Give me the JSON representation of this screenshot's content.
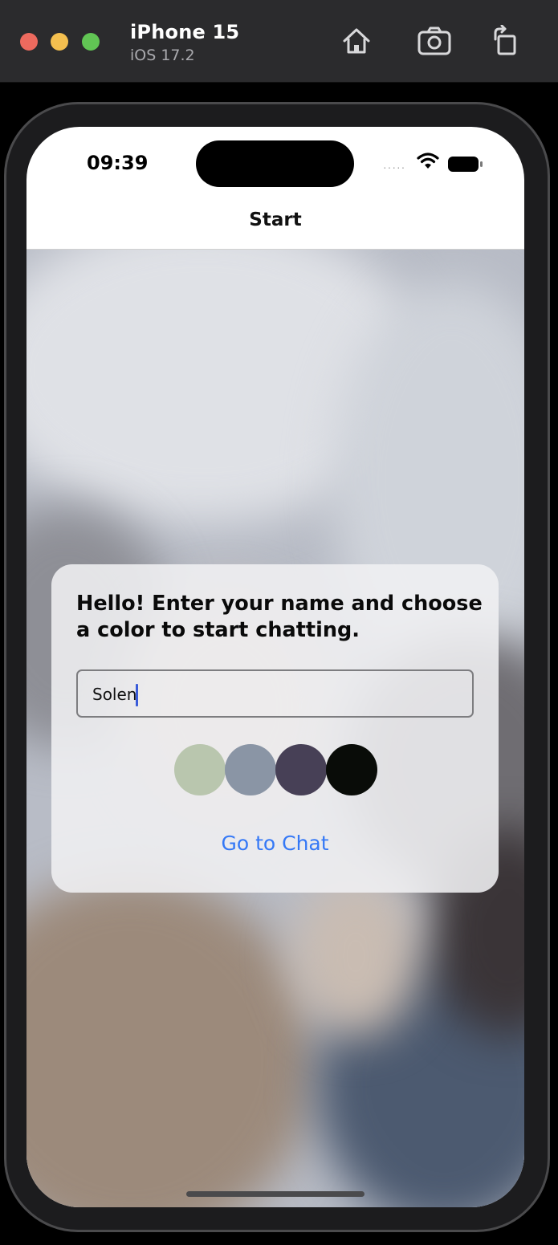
{
  "simulator": {
    "device_name": "iPhone 15",
    "os_version": "iOS 17.2",
    "icons": [
      "home-icon",
      "screenshot-icon",
      "rotate-icon"
    ]
  },
  "status_bar": {
    "time": "09:39",
    "signal": "·····",
    "icons": [
      "wifi-icon",
      "battery-icon"
    ]
  },
  "nav": {
    "title": "Start"
  },
  "start_form": {
    "heading": "Hello! Enter your name and choose a color to start chatting.",
    "name_value": "Solen",
    "colors": [
      {
        "name": "sage",
        "hex": "#b9c6ae"
      },
      {
        "name": "slate",
        "hex": "#8a95a5"
      },
      {
        "name": "dusk",
        "hex": "#474056"
      },
      {
        "name": "black",
        "hex": "#090c08"
      }
    ],
    "go_button": "Go to Chat",
    "accent": "#3478f6"
  }
}
